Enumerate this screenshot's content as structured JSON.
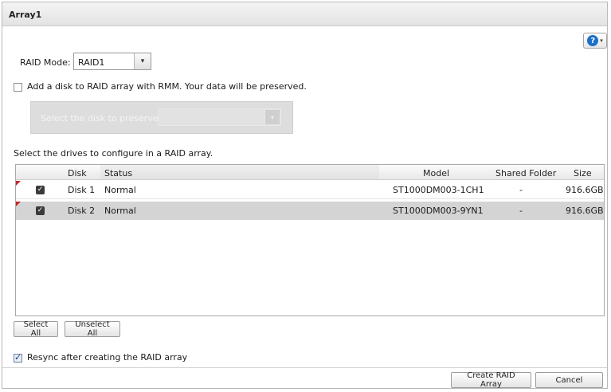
{
  "window": {
    "title": "Array1"
  },
  "help": {
    "icon": "help-icon",
    "glyph": "?",
    "caret": "▾"
  },
  "raid_mode": {
    "label": "RAID Mode:",
    "value": "RAID1",
    "caret": "▾"
  },
  "rmm": {
    "checked": false,
    "label": "Add a disk to RAID array with RMM. Your data will be preserved."
  },
  "preserve": {
    "label": "Select the disk to preserve:",
    "value": "",
    "caret": "▾"
  },
  "drives_section": {
    "label": "Select the drives to configure in a RAID array."
  },
  "table": {
    "headers": {
      "disk": "Disk",
      "status": "Status",
      "model": "Model",
      "shared": "Shared Folder",
      "size": "Size"
    },
    "rows": [
      {
        "checked": true,
        "disk": "Disk 1",
        "status": "Normal",
        "model": "ST1000DM003-1CH1",
        "shared": "-",
        "size": "916.6GB"
      },
      {
        "checked": true,
        "disk": "Disk 2",
        "status": "Normal",
        "model": "ST1000DM003-9YN1",
        "shared": "-",
        "size": "916.6GB"
      }
    ]
  },
  "buttons": {
    "select_all": "Select All",
    "unselect_all": "Unselect All",
    "create": "Create RAID Array",
    "cancel": "Cancel"
  },
  "resync": {
    "checked": true,
    "label": "Resync after creating the RAID array"
  },
  "colors": {
    "selected_row": "#d4d4d4",
    "marker": "#c0262a",
    "help_blue": "#1d6fc7"
  }
}
